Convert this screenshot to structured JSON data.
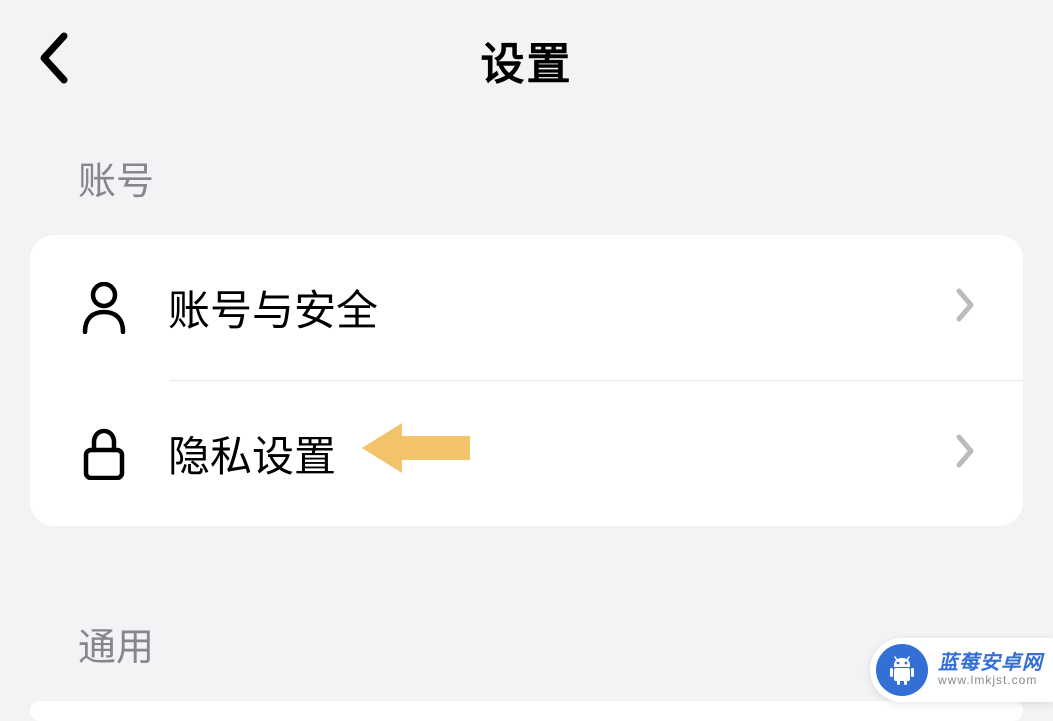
{
  "header": {
    "title": "设置"
  },
  "sections": {
    "account": {
      "header": "账号",
      "items": [
        {
          "icon": "person-icon",
          "label": "账号与安全"
        },
        {
          "icon": "lock-icon",
          "label": "隐私设置"
        }
      ]
    },
    "general": {
      "header": "通用"
    }
  },
  "annotation": {
    "arrow_color": "#f2c368"
  },
  "watermark": {
    "title": "蓝莓安卓网",
    "url": "www.lmkjst.com"
  }
}
